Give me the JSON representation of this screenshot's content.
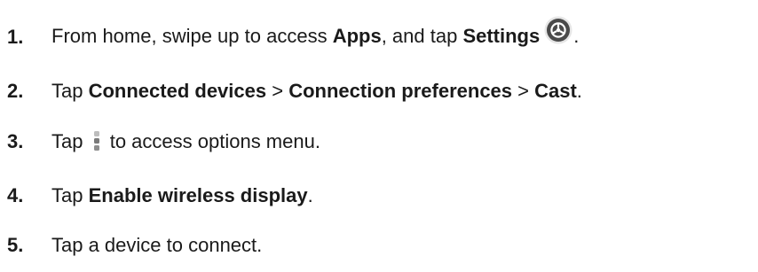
{
  "steps": [
    {
      "number": "1.",
      "parts": [
        "From home, swipe up to access ",
        "Apps",
        ", and tap ",
        "Settings",
        "."
      ],
      "icon": "settings-gear-icon"
    },
    {
      "number": "2.",
      "parts": [
        "Tap ",
        "Connected devices",
        " > ",
        "Connection preferences",
        " > ",
        "Cast",
        "."
      ]
    },
    {
      "number": "3.",
      "parts": [
        "Tap ",
        " to access options menu."
      ],
      "icon": "more-options-kebab-icon"
    },
    {
      "number": "4.",
      "parts": [
        "Tap ",
        "Enable wireless display",
        "."
      ]
    },
    {
      "number": "5.",
      "parts": [
        "Tap a device to connect."
      ]
    }
  ],
  "colors": {
    "text": "#1a1a1a",
    "icon_dark": "#4a4a4a",
    "icon_light": "#bdbdbd"
  }
}
